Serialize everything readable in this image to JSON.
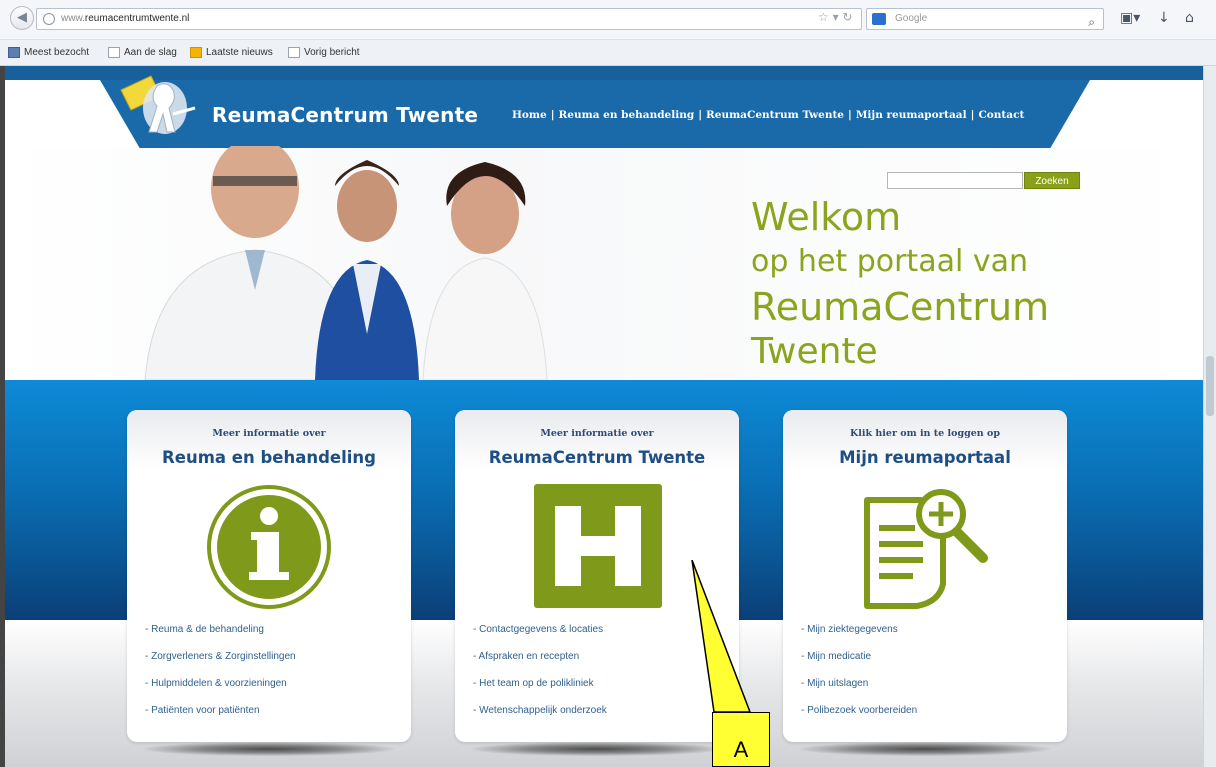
{
  "browser": {
    "url_prefix": "www.",
    "url_domain": "reumacentrumtwente.nl",
    "search_placeholder": "Google",
    "back_icon": "back-arrow-icon",
    "bookmarks": [
      {
        "label": "Meest bezocht",
        "icon": "bookmarks-icon"
      },
      {
        "label": "Aan de slag",
        "icon": "page-icon"
      },
      {
        "label": "Laatste nieuws",
        "icon": "feed-icon"
      },
      {
        "label": "Vorig bericht",
        "icon": "page-icon"
      }
    ]
  },
  "site": {
    "logo_text": "ReumaCentrum Twente",
    "nav": [
      "Home",
      "Reuma en behandeling",
      "ReumaCentrum Twente",
      "Mijn reumaportaal",
      "Contact"
    ],
    "nav_separator": "|",
    "search_button": "Zoeken",
    "welcome": {
      "line1": "Welkom",
      "line2": "op het portaal van",
      "line3": "ReumaCentrum",
      "line4": "Twente"
    },
    "accent_green": "#8ba41e",
    "brand_blue": "#1a6aa9"
  },
  "cards": [
    {
      "kicker": "Meer informatie over",
      "title": "Reuma en behandeling",
      "icon": "info-circle-icon",
      "links": [
        "- Reuma & de behandeling",
        "- Zorgverleners & Zorginstellingen",
        "- Hulpmiddelen & voorzieningen",
        "- Patiënten voor patiënten"
      ]
    },
    {
      "kicker": "Meer informatie over",
      "title": "ReumaCentrum Twente",
      "icon": "hospital-h-icon",
      "links": [
        "- Contactgegevens & locaties",
        "- Afspraken en recepten",
        "- Het team op de polikliniek",
        "- Wetenschappelijk onderzoek"
      ]
    },
    {
      "kicker": "Klik hier om in te loggen op",
      "title": "Mijn reumaportaal",
      "icon": "document-search-icon",
      "links": [
        "- Mijn ziektegegevens",
        "- Mijn medicatie",
        "- Mijn uitslagen",
        "- Polibezoek voorbereiden"
      ]
    }
  ],
  "annotation": {
    "label": "A"
  }
}
